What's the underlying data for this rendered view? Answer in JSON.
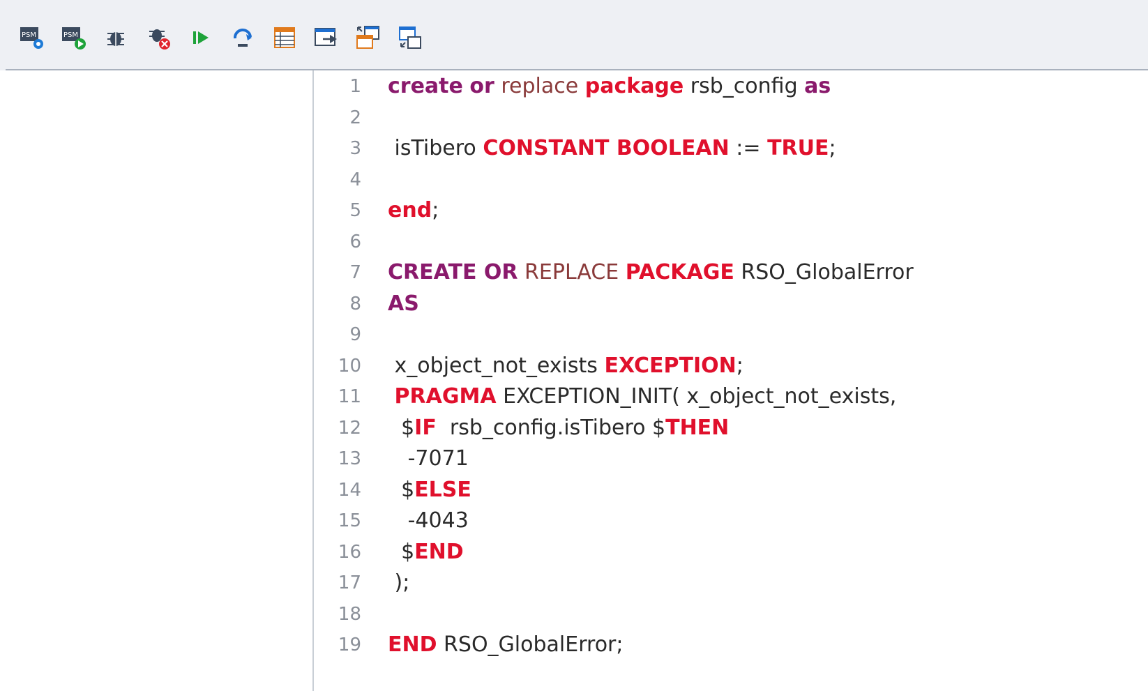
{
  "toolbar": {
    "buttons": [
      {
        "name": "psm-compile-icon",
        "label": "PSM"
      },
      {
        "name": "psm-run-icon",
        "label": "PSM"
      },
      {
        "name": "debug-bug-icon"
      },
      {
        "name": "debug-stop-icon"
      },
      {
        "name": "resume-play-icon"
      },
      {
        "name": "step-over-icon"
      },
      {
        "name": "table-list-icon"
      },
      {
        "name": "window-arrow-icon"
      },
      {
        "name": "split-view-icon"
      },
      {
        "name": "collapse-view-icon"
      }
    ]
  },
  "editor": {
    "line_numbers": [
      "1",
      "2",
      "3",
      "4",
      "5",
      "6",
      "7",
      "8",
      "9",
      "10",
      "11",
      "12",
      "13",
      "14",
      "15",
      "16",
      "17",
      "18",
      "19"
    ],
    "lines": [
      [
        {
          "t": "create",
          "c": "kw1"
        },
        {
          "t": " ",
          "c": "plain"
        },
        {
          "t": "or",
          "c": "kw1"
        },
        {
          "t": " replace ",
          "c": "soft"
        },
        {
          "t": "package",
          "c": "kw2"
        },
        {
          "t": " rsb_config ",
          "c": "plain"
        },
        {
          "t": "as",
          "c": "kw1"
        }
      ],
      [],
      [
        {
          "t": " isTibero ",
          "c": "plain"
        },
        {
          "t": "CONSTANT BOOLEAN",
          "c": "kw2"
        },
        {
          "t": " := ",
          "c": "plain"
        },
        {
          "t": "TRUE",
          "c": "kw2"
        },
        {
          "t": ";",
          "c": "plain"
        }
      ],
      [],
      [
        {
          "t": "end",
          "c": "kw2"
        },
        {
          "t": ";",
          "c": "plain"
        }
      ],
      [],
      [
        {
          "t": "CREATE OR",
          "c": "kw1"
        },
        {
          "t": " REPLACE ",
          "c": "soft"
        },
        {
          "t": "PACKAGE",
          "c": "kw2"
        },
        {
          "t": " RSO_GlobalError",
          "c": "plain"
        }
      ],
      [
        {
          "t": "AS",
          "c": "kw1"
        }
      ],
      [],
      [
        {
          "t": " x_object_not_exists ",
          "c": "plain"
        },
        {
          "t": "EXCEPTION",
          "c": "kw2"
        },
        {
          "t": ";",
          "c": "plain"
        }
      ],
      [
        {
          "t": " ",
          "c": "plain"
        },
        {
          "t": "PRAGMA",
          "c": "kw2"
        },
        {
          "t": " EXCEPTION_INIT( x_object_not_exists,",
          "c": "plain"
        }
      ],
      [
        {
          "t": "  $",
          "c": "plain"
        },
        {
          "t": "IF",
          "c": "kw2"
        },
        {
          "t": "  rsb_config.isTibero $",
          "c": "plain"
        },
        {
          "t": "THEN",
          "c": "kw2"
        }
      ],
      [
        {
          "t": "   -7071",
          "c": "plain"
        }
      ],
      [
        {
          "t": "  $",
          "c": "plain"
        },
        {
          "t": "ELSE",
          "c": "kw2"
        }
      ],
      [
        {
          "t": "   -4043",
          "c": "plain"
        }
      ],
      [
        {
          "t": "  $",
          "c": "plain"
        },
        {
          "t": "END",
          "c": "kw2"
        }
      ],
      [
        {
          "t": " );",
          "c": "plain"
        }
      ],
      [],
      [
        {
          "t": "END",
          "c": "kw2"
        },
        {
          "t": " RSO_GlobalError;",
          "c": "plain"
        }
      ]
    ]
  },
  "colors": {
    "keyword_purple": "#8a1a6c",
    "keyword_red": "#e0102c",
    "toolbar_bg": "#eef0f4"
  }
}
